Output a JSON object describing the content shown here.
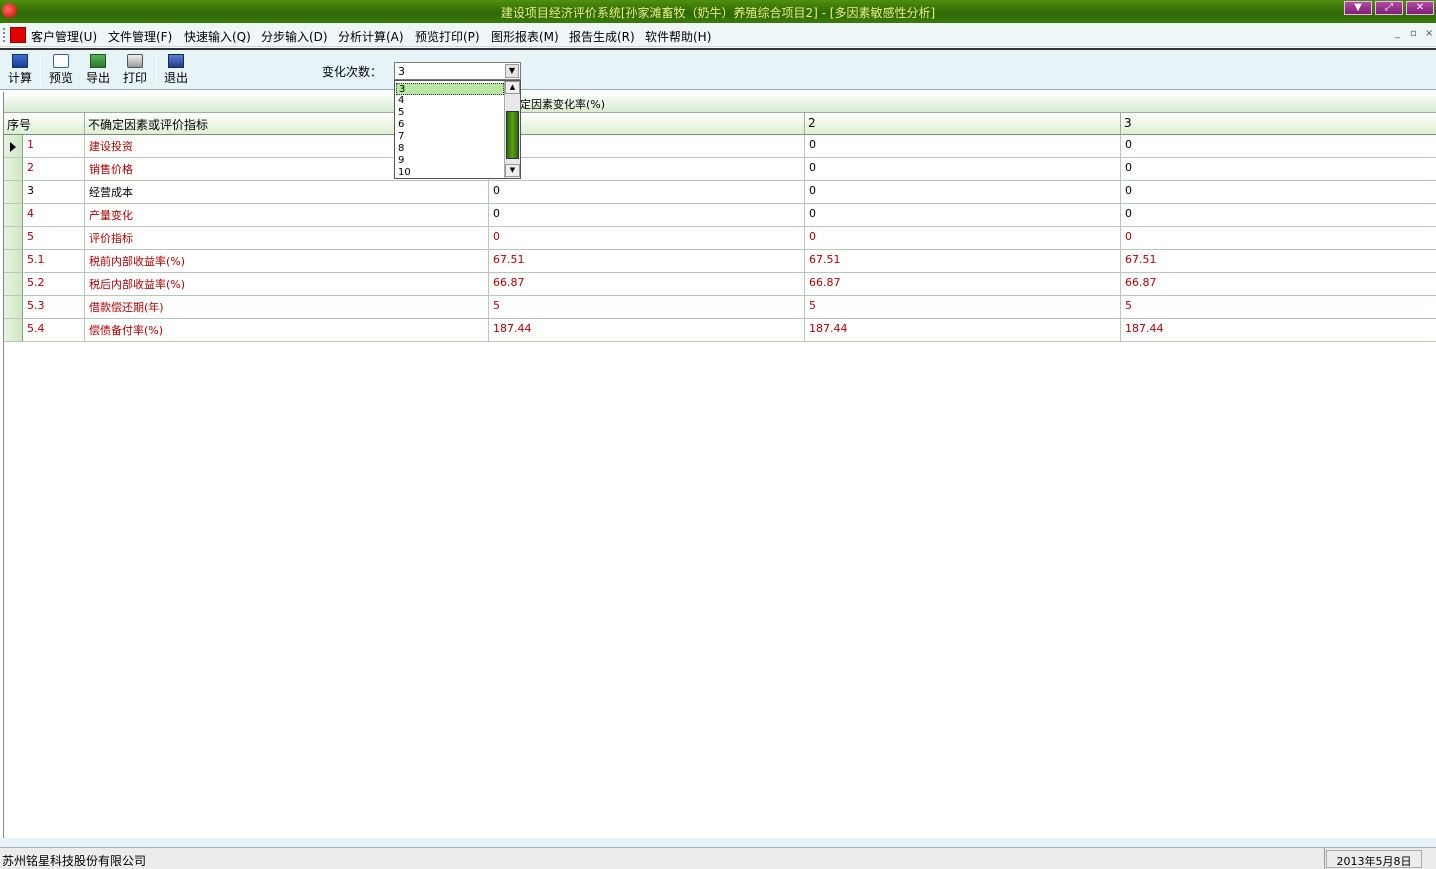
{
  "window": {
    "title": "建设项目经济评价系统[孙家滩畜牧（奶牛）养殖综合项目2] - [多因素敏感性分析]",
    "buttons": {
      "minimize": "▼",
      "restore": "⤢",
      "close": "✕"
    }
  },
  "menu": {
    "items": [
      "客户管理(U)",
      "文件管理(F)",
      "快速输入(Q)",
      "分步输入(D)",
      "分析计算(A)",
      "预览打印(P)",
      "图形报表(M)",
      "报告生成(R)",
      "软件帮助(H)"
    ],
    "mdi": {
      "minimize": "_",
      "restore": "▫",
      "close": "×"
    }
  },
  "toolbar": {
    "buttons": [
      {
        "label": "计算",
        "icon": "calculator-icon"
      },
      {
        "label": "预览",
        "icon": "preview-icon"
      },
      {
        "label": "导出",
        "icon": "export-icon"
      },
      {
        "label": "打印",
        "icon": "printer-icon"
      },
      {
        "label": "退出",
        "icon": "exit-icon"
      }
    ],
    "count_label": "变化次数：",
    "count_value": "3",
    "count_options": [
      "3",
      "4",
      "5",
      "6",
      "7",
      "8",
      "9",
      "10"
    ]
  },
  "grid": {
    "band_label": "定因素变化率(%)",
    "headers": [
      "序号",
      "不确定因素或评价指标",
      "",
      "2",
      "3"
    ],
    "rows": [
      {
        "no": "1",
        "name": "建设投资",
        "v1": "",
        "v2": "0",
        "v3": "0",
        "color": "red",
        "current": true
      },
      {
        "no": "2",
        "name": "销售价格",
        "v1": "",
        "v2": "0",
        "v3": "0",
        "color": "red"
      },
      {
        "no": "3",
        "name": "经营成本",
        "v1": "0",
        "v2": "0",
        "v3": "0",
        "color": "black"
      },
      {
        "no": "4",
        "name": "产量变化",
        "v1": "0",
        "v2": "0",
        "v3": "0",
        "color": "red"
      },
      {
        "no": "5",
        "name": "评价指标",
        "v1": "0",
        "v2": "0",
        "v3": "0",
        "color": "red"
      },
      {
        "no": "5.1",
        "name": "税前内部收益率(%)",
        "v1": "67.51",
        "v2": "67.51",
        "v3": "67.51",
        "color": "red"
      },
      {
        "no": "5.2",
        "name": "税后内部收益率(%)",
        "v1": "66.87",
        "v2": "66.87",
        "v3": "66.87",
        "color": "red"
      },
      {
        "no": "5.3",
        "name": "借款偿还期(年)",
        "v1": "5",
        "v2": "5",
        "v3": "5",
        "color": "red"
      },
      {
        "no": "5.4",
        "name": "偿债备付率(%)",
        "v1": "187.44",
        "v2": "187.44",
        "v3": "187.44",
        "color": "red"
      }
    ]
  },
  "status": {
    "company": "苏州铭星科技股份有限公司",
    "date": "2013年5月8日"
  }
}
